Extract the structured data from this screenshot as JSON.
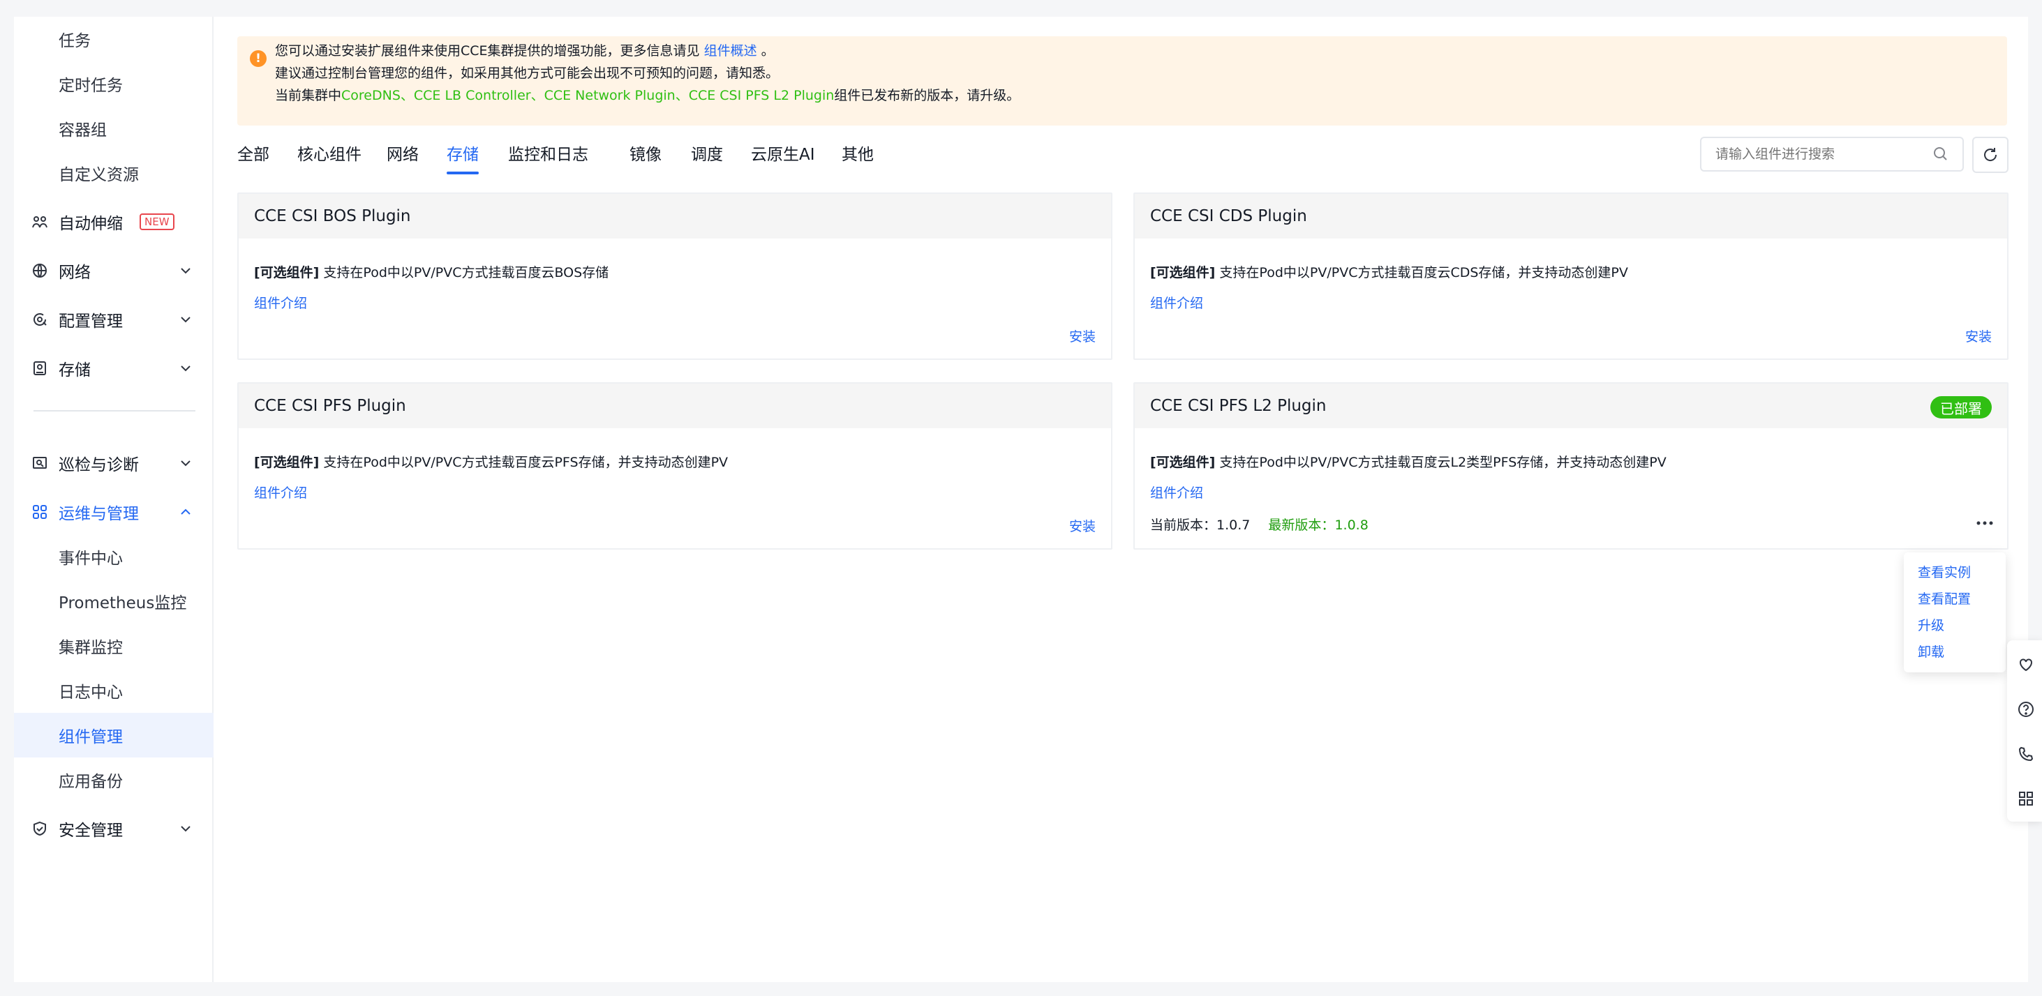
{
  "sidebar": {
    "items": [
      {
        "label": "任务",
        "type": "sub"
      },
      {
        "label": "定时任务",
        "type": "sub"
      },
      {
        "label": "容器组",
        "type": "sub"
      },
      {
        "label": "自定义资源",
        "type": "sub"
      },
      {
        "label": "自动伸缩",
        "type": "top",
        "icon": "autoscale-icon",
        "badge": "NEW"
      },
      {
        "label": "网络",
        "type": "top",
        "icon": "globe-icon"
      },
      {
        "label": "配置管理",
        "type": "top",
        "icon": "config-icon"
      },
      {
        "label": "存储",
        "type": "top",
        "icon": "storage-icon"
      },
      {
        "label": "巡检与诊断",
        "type": "top",
        "icon": "inspect-icon"
      },
      {
        "label": "运维与管理",
        "type": "top",
        "icon": "ops-icon",
        "expanded": true
      },
      {
        "label": "事件中心",
        "type": "sub"
      },
      {
        "label": "Prometheus监控",
        "type": "sub"
      },
      {
        "label": "集群监控",
        "type": "sub"
      },
      {
        "label": "日志中心",
        "type": "sub"
      },
      {
        "label": "组件管理",
        "type": "sub",
        "active": true
      },
      {
        "label": "应用备份",
        "type": "sub"
      },
      {
        "label": "安全管理",
        "type": "top",
        "icon": "security-icon"
      }
    ]
  },
  "notice": {
    "line1_text": "您可以通过安装扩展组件来使用CCE集群提供的增强功能，更多信息请见",
    "line1_link": "组件概述",
    "line1_end": "。",
    "line2": "建议通过控制台管理您的组件，如采用其他方式可能会出现不可预知的问题，请知悉。",
    "line3_prefix": "当前集群中",
    "line3_components": "CoreDNS、CCE LB Controller、CCE Network Plugin、CCE CSI PFS L2 Plugin",
    "line3_suffix": "组件已发布新的版本，请升级。"
  },
  "tabs": [
    "全部",
    "核心组件",
    "网络",
    "存储",
    "监控和日志",
    "镜像",
    "调度",
    "云原生AI",
    "其他"
  ],
  "active_tab": "存储",
  "search": {
    "placeholder": "请输入组件进行搜索"
  },
  "cards": [
    {
      "title": "CCE CSI BOS Plugin",
      "tag": "[可选组件]",
      "desc": "支持在Pod中以PV/PVC方式挂载百度云BOS存储",
      "link": "组件介绍",
      "action": "安装"
    },
    {
      "title": "CCE CSI CDS Plugin",
      "tag": "[可选组件]",
      "desc": "支持在Pod中以PV/PVC方式挂载百度云CDS存储，并支持动态创建PV",
      "link": "组件介绍",
      "action": "安装"
    },
    {
      "title": "CCE CSI PFS Plugin",
      "tag": "[可选组件]",
      "desc": "支持在Pod中以PV/PVC方式挂载百度云PFS存储，并支持动态创建PV",
      "link": "组件介绍",
      "action": "安装"
    },
    {
      "title": "CCE CSI PFS L2 Plugin",
      "tag": "[可选组件]",
      "desc": "支持在Pod中以PV/PVC方式挂载百度云L2类型PFS存储，并支持动态创建PV",
      "link": "组件介绍",
      "status": "已部署",
      "current_version_label": "当前版本：",
      "current_version": "1.0.7",
      "latest_version_label": "最新版本：",
      "latest_version": "1.0.8"
    }
  ],
  "dropdown": [
    "查看实例",
    "查看配置",
    "升级",
    "卸载"
  ],
  "colors": {
    "accent": "#2468f2",
    "success": "#30bf13",
    "warning_bg": "#fff4e6",
    "warning_icon": "#ff9326",
    "new_badge": "#e8464d"
  }
}
